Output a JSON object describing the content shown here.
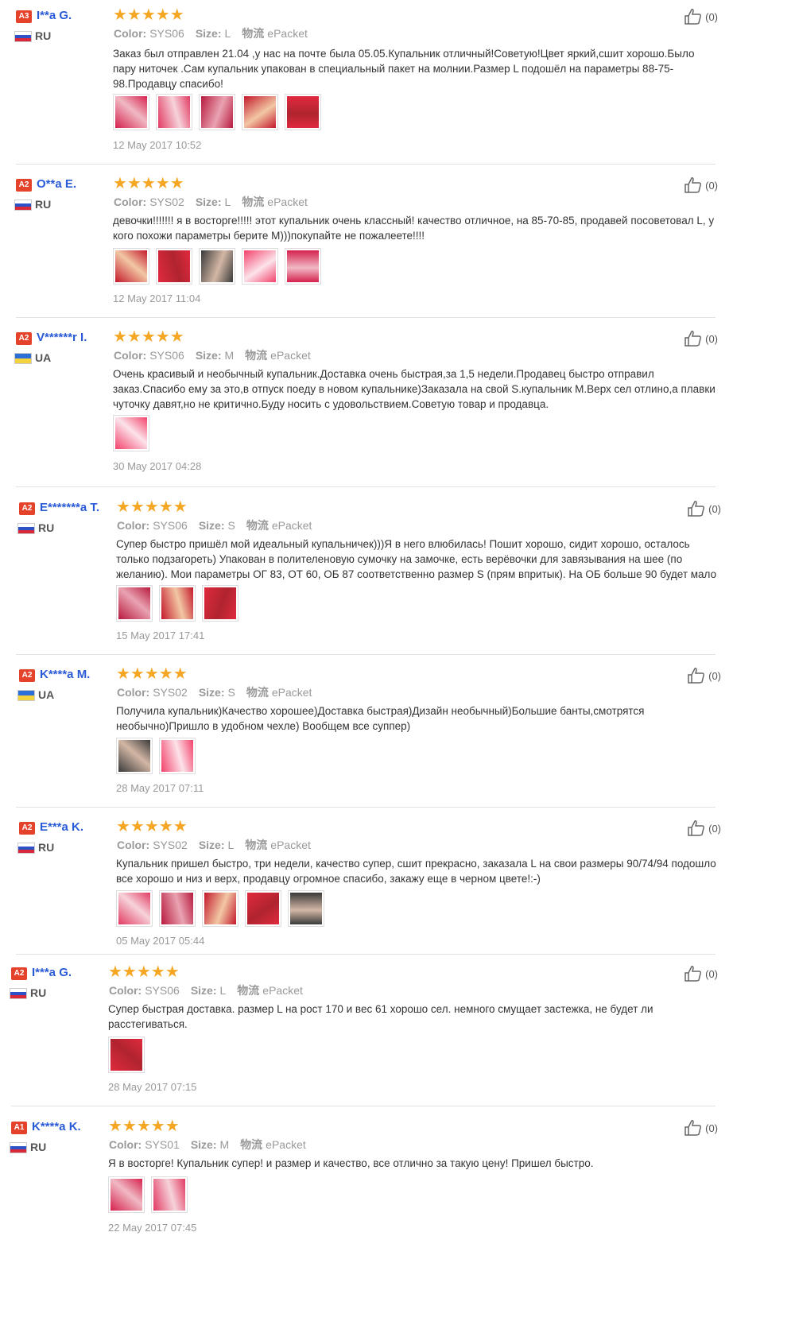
{
  "reviews": [
    {
      "level": "A3",
      "name": "I**a G.",
      "country": "RU",
      "flag": "ru",
      "color_label": "Color:",
      "color": "SYS06",
      "size_label": "Size:",
      "size": "L",
      "ship_label": "物流",
      "shipping": "ePacket",
      "text": "Заказ был отправлен 21.04 ,у нас на почте была 05.05.Купальник отличный!Советую!Цвет яркий,сшит хорошо.Было пару ниточек .Сам купальник упакован в специальный пакет на молнии.Размер L подошёл на параметры 88-75-98.Продавцу спасибо!",
      "photos": 5,
      "date": "12 May 2017 10:52",
      "likes": "(0)"
    },
    {
      "level": "A2",
      "name": "O**a E.",
      "country": "RU",
      "flag": "ru",
      "color_label": "Color:",
      "color": "SYS02",
      "size_label": "Size:",
      "size": "L",
      "ship_label": "物流",
      "shipping": "ePacket",
      "text": "девочки!!!!!!! я в восторге!!!!! этот купальник очень классный! качество отличное, на 85-70-85, продавей посоветовал L, у кого похожи параметры берите М)))покупайте не пожалеете!!!!",
      "photos": 5,
      "date": "12 May 2017 11:04",
      "likes": "(0)"
    },
    {
      "level": "A2",
      "name": "V******r I.",
      "country": "UA",
      "flag": "ua",
      "color_label": "Color:",
      "color": "SYS06",
      "size_label": "Size:",
      "size": "M",
      "ship_label": "物流",
      "shipping": "ePacket",
      "text": "Очень красивый и необычный купальник.Доставка очень быстрая,за 1,5 недели.Продавец быстро отправил заказ.Спасибо ему за это,в отпуск поеду в новом купальнике)Заказала на свой S.купальник М.Верх сел отлино,а плавки чуточку давят,но не критично.Буду носить с удовольствием.Советую товар и продавца.",
      "photos": 1,
      "date": "30 May 2017 04:28",
      "likes": "(0)"
    },
    {
      "level": "A2",
      "name": "E*******a T.",
      "country": "RU",
      "flag": "ru",
      "color_label": "Color:",
      "color": "SYS06",
      "size_label": "Size:",
      "size": "S",
      "ship_label": "物流",
      "shipping": "ePacket",
      "text": "Супер быстро пришёл мой идеальный купальничек)))Я в него влюбилась! Пошит хорошо, сидит хорошо, осталось только подзагореть) Упакован в полителеновую сумочку на замочке, есть верёвочки для завязывания на шее (по желанию). Мои параметры ОГ 83, ОТ 60, ОБ 87 соответственно размер S (прям впритык). На ОБ больше 90 будет мало",
      "photos": 3,
      "date": "15 May 2017 17:41",
      "likes": "(0)"
    },
    {
      "level": "A2",
      "name": "K****a M.",
      "country": "UA",
      "flag": "ua",
      "color_label": "Color:",
      "color": "SYS02",
      "size_label": "Size:",
      "size": "S",
      "ship_label": "物流",
      "shipping": "ePacket",
      "text": "Получила купальник)Качество хорошее)Доставка быстрая)Дизайн необычный)Большие банты,смотрятся необычно)Пришло в удобном чехле) Вообщем все суппер)",
      "photos": 2,
      "date": "28 May 2017 07:11",
      "likes": "(0)"
    },
    {
      "level": "A2",
      "name": "E***a K.",
      "country": "RU",
      "flag": "ru",
      "color_label": "Color:",
      "color": "SYS02",
      "size_label": "Size:",
      "size": "L",
      "ship_label": "物流",
      "shipping": "ePacket",
      "text": "Купальник пришел быстро, три недели, качество супер, сшит прекрасно, заказала L на свои размеры 90/74/94 подошло все хорошо и низ и верх, продавцу огромное спасибо, закажу еще в черном цвете!:-)",
      "photos": 5,
      "date": "05 May 2017 05:44",
      "likes": "(0)"
    },
    {
      "level": "A2",
      "name": "I***a G.",
      "country": "RU",
      "flag": "ru",
      "color_label": "Color:",
      "color": "SYS06",
      "size_label": "Size:",
      "size": "L",
      "ship_label": "物流",
      "shipping": "ePacket",
      "text": "Супер быстрая доставка. размер L на рост 170 и вес 61 хорошо сел. немного смущает застежка, не будет ли расстегиваться.",
      "photos": 1,
      "date": "28 May 2017 07:15",
      "likes": "(0)"
    },
    {
      "level": "A1",
      "name": "K****a K.",
      "country": "RU",
      "flag": "ru",
      "color_label": "Color:",
      "color": "SYS01",
      "size_label": "Size:",
      "size": "M",
      "ship_label": "物流",
      "shipping": "ePacket",
      "text": "Я в восторге! Купальник супер! и размер и качество, все отлично за такую цену! Пришел быстро.",
      "photos": 2,
      "date": "22 May 2017 07:45",
      "likes": "(0)"
    }
  ]
}
